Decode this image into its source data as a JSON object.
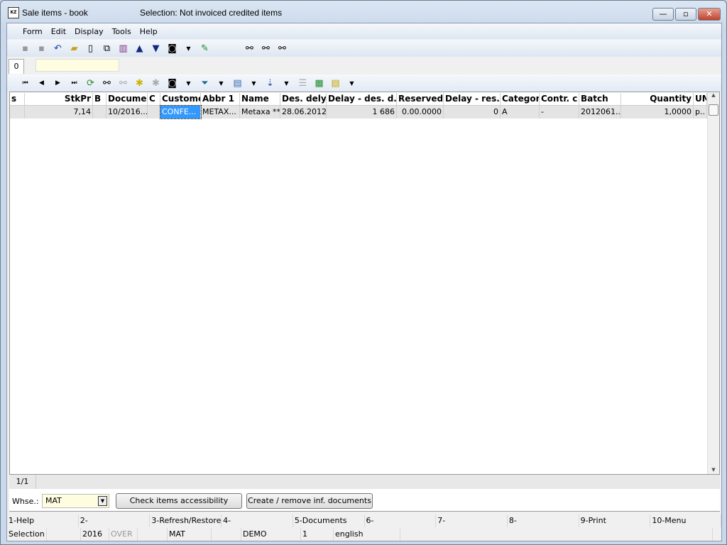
{
  "window": {
    "title": "Sale items - book",
    "selection_title": "Selection: Not invoiced credited items",
    "minimize": "—",
    "maximize": "▫",
    "close": "✕",
    "app_icon": "KZ"
  },
  "menu": [
    "Form",
    "Edit",
    "Display",
    "Tools",
    "Help"
  ],
  "toolbar_icons": [
    "save-icon",
    "save-as-icon",
    "undo-icon",
    "open-folder-icon",
    "new-document-icon",
    "copy-icon",
    "book-icon",
    "arrow-up-icon",
    "arrow-down-icon",
    "camera-icon",
    "dropdown-icon",
    "excel-export-icon",
    "find-icon",
    "find-next-icon",
    "find-prev-icon"
  ],
  "tab": {
    "label": "0",
    "input_value": ""
  },
  "grid_toolbar_icons": [
    "first-icon",
    "prev-icon",
    "next-icon",
    "last-icon",
    "refresh-icon",
    "find-icon",
    "find-disabled-icon",
    "add-star-icon",
    "remove-icon",
    "camera-icon",
    "filter-icon",
    "export-icon",
    "sort-az-icon",
    "list-icon",
    "excel-icon",
    "columns-icon"
  ],
  "grid": {
    "columns": [
      "s",
      "StkPr",
      "B",
      "Documer",
      "C",
      "Custome",
      "Abbr 1",
      "Name",
      "Des. dely",
      "Delay - des. d.",
      "Reserved",
      "Delay - res.",
      "Categor",
      "Contr. c",
      "Batch",
      "Quantity",
      "UM"
    ],
    "rows": [
      [
        "",
        "7,14",
        "",
        "10/2016...",
        "",
        "CONFE...",
        "METAX...",
        "Metaxa ***",
        "28.06.2012",
        "1 686",
        "0.00.0000",
        "0",
        "A",
        "-",
        "2012061...",
        "1,0000",
        "p.."
      ]
    ],
    "selected_cell": "CONFE..."
  },
  "pager": "1/1",
  "controls": {
    "whse_label": "Whse.:",
    "whse_value": "MAT",
    "check_button": "Check items accessibility",
    "create_button": "Create / remove inf. documents"
  },
  "fkeys": [
    "1-Help",
    "2-",
    "3-Refresh/Restore",
    "4-",
    "5-Documents",
    "6-",
    "7-",
    "8-",
    "9-Print",
    "10-Menu"
  ],
  "status": [
    "Selection",
    "",
    "2016",
    "OVER",
    "",
    "MAT",
    "",
    "DEMO",
    "1",
    "english",
    ""
  ]
}
